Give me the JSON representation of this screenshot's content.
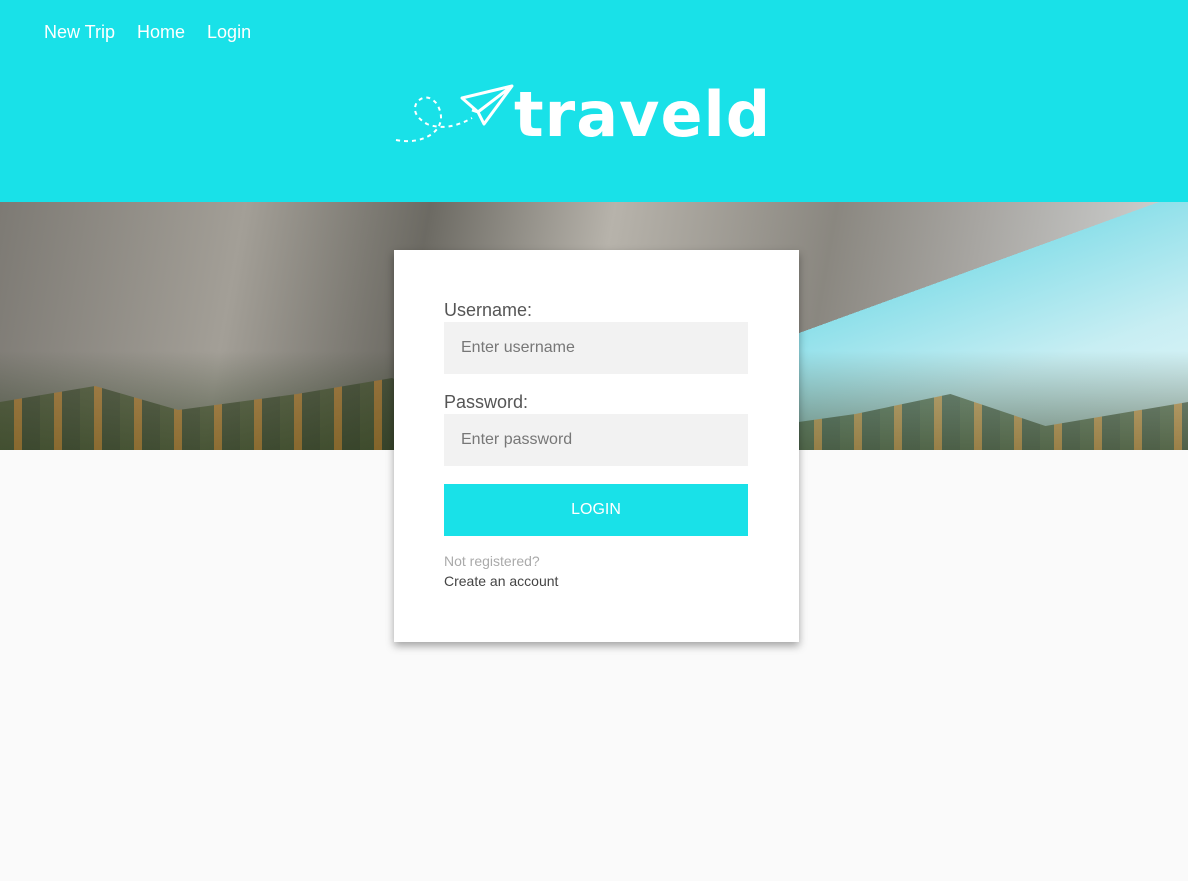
{
  "nav": {
    "items": [
      "New Trip",
      "Home",
      "Login"
    ]
  },
  "logo": {
    "text": "traveld"
  },
  "login_form": {
    "username_label": "Username:",
    "username_placeholder": "Enter username",
    "password_label": "Password:",
    "password_placeholder": "Enter password",
    "login_button": "LOGIN",
    "not_registered": "Not registered?",
    "create_account": "Create an account"
  },
  "colors": {
    "accent": "#19e1e8"
  }
}
